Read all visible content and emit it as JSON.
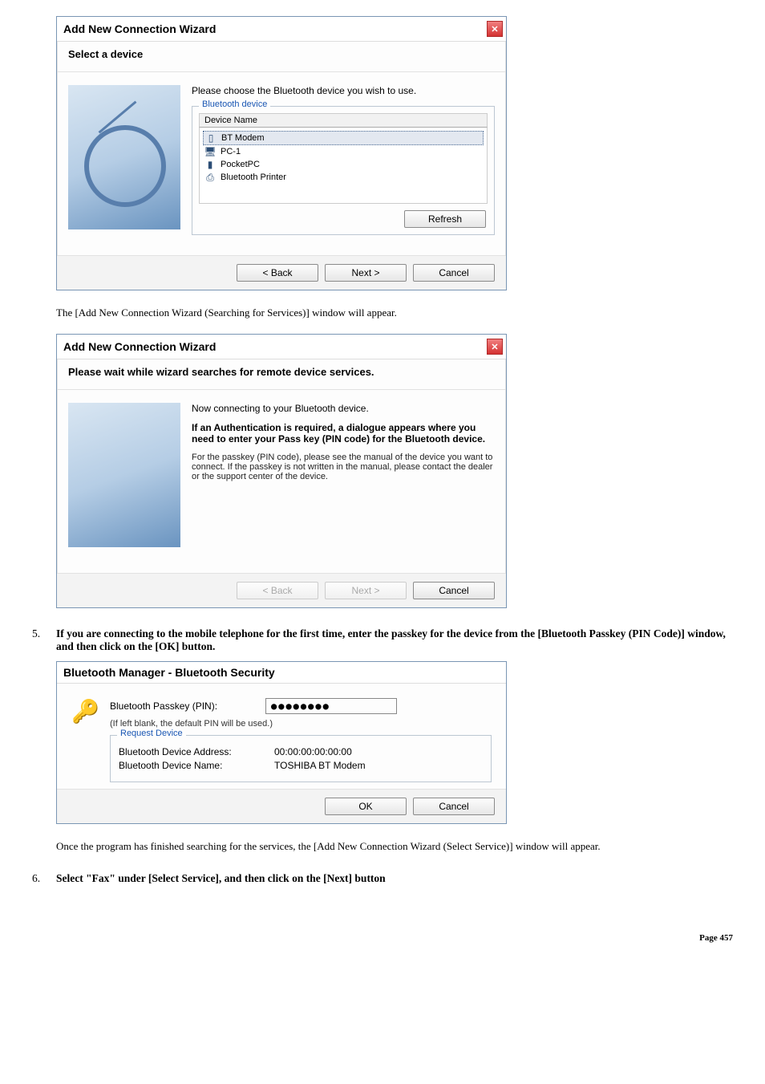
{
  "dialog1": {
    "title": "Add New Connection Wizard",
    "subtitle": "Select a device",
    "instruction": "Please choose the Bluetooth device you wish to use.",
    "group_label": "Bluetooth device",
    "col_header": "Device Name",
    "devices": [
      {
        "name": "BT Modem"
      },
      {
        "name": "PC-1"
      },
      {
        "name": "PocketPC"
      },
      {
        "name": "Bluetooth Printer"
      }
    ],
    "refresh": "Refresh",
    "back": "< Back",
    "next": "Next >",
    "cancel": "Cancel"
  },
  "para1": "The [Add New Connection Wizard (Searching for Services)] window will appear.",
  "dialog2": {
    "title": "Add New Connection Wizard",
    "subtitle": "Please wait while wizard searches for remote device services.",
    "connect": "Now connecting to your Bluetooth device.",
    "auth_bold": "If an Authentication is required, a dialogue appears where you need to enter your Pass key (PIN code) for the Bluetooth device.",
    "note": "For the passkey (PIN code), please see the manual of the device you want to connect. If the passkey is not written in the manual, please contact the dealer or the support center of the device.",
    "back": "< Back",
    "next": "Next >",
    "cancel": "Cancel"
  },
  "step5_num": "5.",
  "step5": "If you are connecting to the mobile telephone for the first time, enter the passkey for the device from the [Bluetooth Passkey (PIN Code)] window, and then click on the [OK] button.",
  "dialog3": {
    "title": "Bluetooth Manager - Bluetooth Security",
    "pin_label": "Bluetooth Passkey (PIN):",
    "pin_value": "●●●●●●●●",
    "hint": "(If left blank, the default PIN will be used.)",
    "group_label": "Request Device",
    "addr_label": "Bluetooth Device Address:",
    "addr_value": "00:00:00:00:00:00",
    "name_label": "Bluetooth Device Name:",
    "name_value": "TOSHIBA BT Modem",
    "ok": "OK",
    "cancel": "Cancel"
  },
  "para2": "Once the program has finished searching for the services, the [Add New Connection Wizard (Select Service)] window will appear.",
  "step6_num": "6.",
  "step6": "Select \"Fax\" under [Select Service], and then click on the [Next] button",
  "page_label": "Page 457"
}
